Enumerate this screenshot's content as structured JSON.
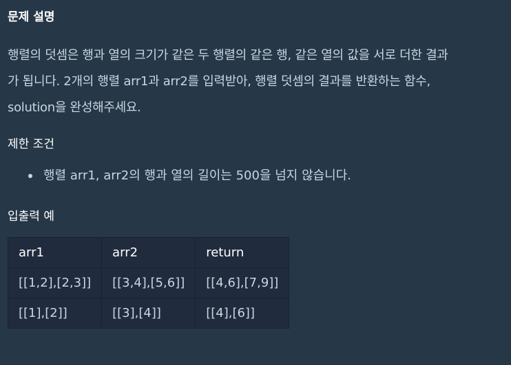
{
  "problem": {
    "title": "문제 설명",
    "description_lines": [
      "행렬의 덧셈은 행과 열의 크기가 같은 두 행렬의 같은 행, 같은 열의 값을 서로 더한 결과",
      "가 됩니다. 2개의 행렬 arr1과 arr2를 입력받아, 행렬 덧셈의 결과를 반환하는 함수,",
      "solution을 완성해주세요."
    ],
    "constraints_title": "제한 조건",
    "constraints": [
      "행렬 arr1, arr2의 행과 열의 길이는 500을 넘지 않습니다."
    ],
    "examples_title": "입출력 예",
    "examples_table": {
      "headers": [
        "arr1",
        "arr2",
        "return"
      ],
      "rows": [
        [
          "[[1,2],[2,3]]",
          "[[3,4],[5,6]]",
          "[[4,6],[7,9]]"
        ],
        [
          "[[1],[2]]",
          "[[3],[4]]",
          "[[4],[6]]"
        ]
      ]
    }
  },
  "colors": {
    "background": "#263747",
    "text": "#c9d6e2",
    "heading": "#ffffff",
    "table_bg": "#202b3d",
    "table_border": "#172334"
  }
}
